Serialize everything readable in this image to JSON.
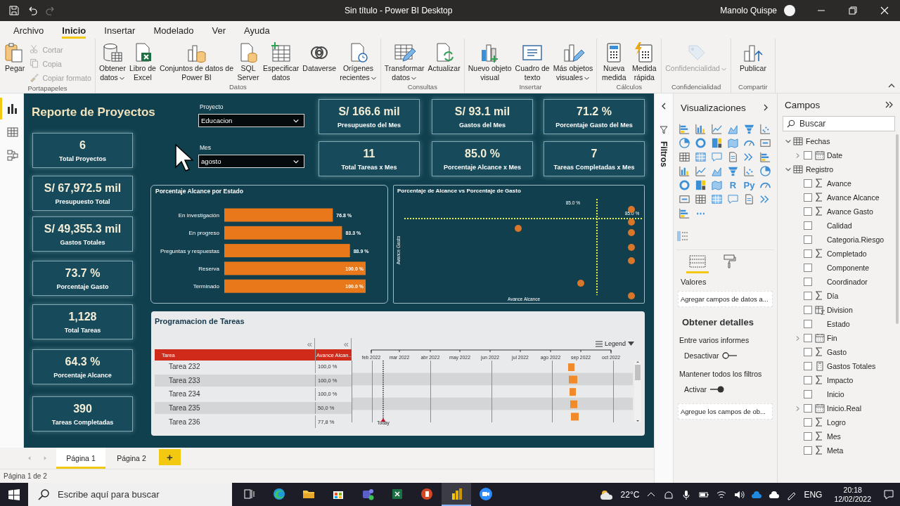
{
  "window": {
    "title": "Sin título - Power BI Desktop",
    "user": "Manolo Quispe"
  },
  "ribbon_tabs": [
    {
      "label": "Archivo",
      "selected": false
    },
    {
      "label": "Inicio",
      "selected": true
    },
    {
      "label": "Insertar",
      "selected": false
    },
    {
      "label": "Modelado",
      "selected": false
    },
    {
      "label": "Ver",
      "selected": false
    },
    {
      "label": "Ayuda",
      "selected": false
    }
  ],
  "ribbon_groups": [
    {
      "name": "Portapapeles",
      "buttons": [
        {
          "label": "Pegar",
          "kind": "large",
          "disabled": false,
          "menu": false
        },
        {
          "label": "Cortar",
          "kind": "small",
          "disabled": true,
          "menu": false
        },
        {
          "label": "Copia",
          "kind": "small",
          "disabled": true,
          "menu": false
        },
        {
          "label": "Copiar formato",
          "kind": "small",
          "disabled": true,
          "menu": false
        }
      ]
    },
    {
      "name": "Datos",
      "buttons": [
        {
          "label": "Obtener\ndatos",
          "kind": "large",
          "disabled": false,
          "menu": true
        },
        {
          "label": "Libro de\nExcel",
          "kind": "large",
          "disabled": false,
          "menu": false
        },
        {
          "label": "Conjuntos de datos de\nPower BI",
          "kind": "large",
          "disabled": false,
          "menu": false
        },
        {
          "label": "SQL\nServer",
          "kind": "large",
          "disabled": false,
          "menu": false
        },
        {
          "label": "Especificar\ndatos",
          "kind": "large",
          "disabled": false,
          "menu": false
        },
        {
          "label": "Dataverse",
          "kind": "large",
          "disabled": false,
          "menu": false
        },
        {
          "label": "Orígenes\nrecientes",
          "kind": "large",
          "disabled": false,
          "menu": true
        }
      ]
    },
    {
      "name": "Consultas",
      "buttons": [
        {
          "label": "Transformar\ndatos",
          "kind": "large",
          "disabled": false,
          "menu": true
        },
        {
          "label": "Actualizar",
          "kind": "large",
          "disabled": false,
          "menu": false
        }
      ]
    },
    {
      "name": "Insertar",
      "buttons": [
        {
          "label": "Nuevo objeto\nvisual",
          "kind": "large",
          "disabled": false,
          "menu": false
        },
        {
          "label": "Cuadro de\ntexto",
          "kind": "large",
          "disabled": false,
          "menu": false
        },
        {
          "label": "Más objetos\nvisuales",
          "kind": "large",
          "disabled": false,
          "menu": true
        }
      ]
    },
    {
      "name": "Cálculos",
      "buttons": [
        {
          "label": "Nueva\nmedida",
          "kind": "large",
          "disabled": false,
          "menu": false
        },
        {
          "label": "Medida\nrápida",
          "kind": "large",
          "disabled": false,
          "menu": false
        }
      ]
    },
    {
      "name": "Confidencialidad",
      "buttons": [
        {
          "label": "Confidencialidad",
          "kind": "large",
          "disabled": true,
          "menu": true
        }
      ]
    },
    {
      "name": "Compartir",
      "buttons": [
        {
          "label": "Publicar",
          "kind": "large",
          "disabled": false,
          "menu": false
        }
      ]
    }
  ],
  "view_rail": [
    {
      "selected": true
    },
    {
      "selected": false
    },
    {
      "selected": false
    }
  ],
  "report": {
    "title": "Reporte de Proyectos",
    "slicers": [
      {
        "label": "Proyecto",
        "value": "Educacion"
      },
      {
        "label": "Mes",
        "value": "agosto"
      }
    ],
    "side_cards": [
      {
        "value": "6",
        "label": "Total Proyectos"
      },
      {
        "value": "S/ 67,972.5 mil",
        "label": "Presupuesto Total"
      },
      {
        "value": "S/ 49,355.3 mil",
        "label": "Gastos Totales"
      },
      {
        "value": "73.7 %",
        "label": "Porcentaje Gasto"
      },
      {
        "value": "1,128",
        "label": "Total Tareas"
      },
      {
        "value": "64.3 %",
        "label": "Porcentaje Alcance"
      },
      {
        "value": "390",
        "label": "Tareas Completadas"
      }
    ],
    "top_cards": [
      {
        "value": "S/ 166.6 mil",
        "label": "Presupuesto del Mes"
      },
      {
        "value": "S/ 93.1 mil",
        "label": "Gastos del Mes"
      },
      {
        "value": "71.2 %",
        "label": "Porcentaje Gasto del Mes"
      },
      {
        "value": "11",
        "label": "Total Tareas x Mes"
      },
      {
        "value": "85.0 %",
        "label": "Porcentaje Alcance x Mes"
      },
      {
        "value": "7",
        "label": "Tareas Completadas x Mes"
      }
    ],
    "bar_chart": {
      "chart_data": {
        "type": "bar",
        "orientation": "horizontal",
        "title": "Porcentaje Alcance por Estado",
        "categories": [
          "En investigación",
          "En progreso",
          "Preguntas y respuestas",
          "Reserva",
          "Terminado"
        ],
        "values": [
          76.8,
          83.3,
          88.9,
          100.0,
          100.0
        ],
        "value_labels": [
          "76.8 %",
          "83.3 %",
          "88.9 %",
          "100.0 %",
          "100.0 %"
        ]
      }
    },
    "scatter": {
      "title": "Porcentaje de Alcance vs Porcentaje de Gasto",
      "xlabel": "Avance Alcance",
      "ylabel": "Avance Gasto",
      "reference_labels": [
        "85.0 %",
        "85.0 %"
      ]
    },
    "gantt": {
      "title": "Programacion de Tareas",
      "collapse_buttons": [
        "«",
        "«"
      ],
      "legend": "Legend",
      "columns": [
        "Tarea",
        "Avance Alcan..."
      ],
      "months": [
        "feb 2022",
        "mar 2022",
        "abr 2022",
        "may 2022",
        "jun 2022",
        "jul 2022",
        "ago 2022",
        "sep 2022",
        "oct 2022"
      ],
      "rows": [
        {
          "task": "Tarea 232",
          "progress": "100,0 %"
        },
        {
          "task": "Tarea 233",
          "progress": "100,0 %"
        },
        {
          "task": "Tarea 234",
          "progress": "100,0 %"
        },
        {
          "task": "Tarea 235",
          "progress": "50,0 %"
        },
        {
          "task": "Tarea 236",
          "progress": "77,8 %"
        }
      ],
      "today": "Today"
    }
  },
  "filters_pane": {
    "label": "Filtros"
  },
  "visualizations": {
    "title": "Visualizaciones",
    "gallery": [
      {
        "kind": "icon"
      },
      {
        "kind": "icon"
      },
      {
        "kind": "icon"
      },
      {
        "kind": "icon"
      },
      {
        "kind": "icon"
      },
      {
        "kind": "icon"
      },
      {
        "kind": "icon"
      },
      {
        "kind": "icon"
      },
      {
        "kind": "icon"
      },
      {
        "kind": "icon"
      },
      {
        "kind": "icon"
      },
      {
        "kind": "icon"
      },
      {
        "kind": "icon"
      },
      {
        "kind": "icon"
      },
      {
        "kind": "icon"
      },
      {
        "kind": "icon"
      },
      {
        "kind": "icon"
      },
      {
        "kind": "icon"
      },
      {
        "kind": "icon"
      },
      {
        "kind": "icon"
      },
      {
        "kind": "icon"
      },
      {
        "kind": "icon"
      },
      {
        "kind": "icon"
      },
      {
        "kind": "icon"
      },
      {
        "kind": "icon"
      },
      {
        "kind": "icon"
      },
      {
        "kind": "icon"
      },
      {
        "kind": "text",
        "label": "R"
      },
      {
        "kind": "text",
        "label": "Py"
      },
      {
        "kind": "icon"
      },
      {
        "kind": "icon"
      },
      {
        "kind": "icon"
      },
      {
        "kind": "icon"
      },
      {
        "kind": "icon"
      },
      {
        "kind": "icon"
      },
      {
        "kind": "icon"
      },
      {
        "kind": "icon"
      },
      {
        "kind": "text",
        "label": "⋯"
      }
    ],
    "well_tabs": [
      {
        "selected": true
      },
      {
        "selected": false
      }
    ],
    "well_label": "Valores",
    "well_hint": "Agregar campos de datos a...",
    "drill_title": "Obtener detalles",
    "settings": [
      {
        "label": "Entre varios informes",
        "toggle_label": "Desactivar",
        "on": false
      },
      {
        "label": "Mantener todos los filtros",
        "toggle_label": "Activar",
        "on": true
      }
    ],
    "drill_hint": "Agregue los campos de ob..."
  },
  "fields": {
    "title": "Campos",
    "search_placeholder": "Buscar",
    "tables": [
      {
        "name": "Fechas",
        "expanded": true,
        "children": [
          {
            "name": "Date",
            "kind": "date",
            "expanded": false,
            "checked": false
          }
        ]
      },
      {
        "name": "Registro",
        "expanded": true,
        "children": [
          {
            "name": "Avance",
            "kind": "sum",
            "checked": false
          },
          {
            "name": "Avance Alcance",
            "kind": "sum",
            "checked": false
          },
          {
            "name": "Avance Gasto",
            "kind": "sum",
            "checked": false
          },
          {
            "name": "Calidad",
            "kind": "text",
            "checked": false
          },
          {
            "name": "Categoria.Riesgo",
            "kind": "text",
            "checked": false
          },
          {
            "name": "Completado",
            "kind": "sum",
            "checked": false
          },
          {
            "name": "Componente",
            "kind": "text",
            "checked": false
          },
          {
            "name": "Coordinador",
            "kind": "text",
            "checked": false
          },
          {
            "name": "Día",
            "kind": "sum",
            "checked": false
          },
          {
            "name": "Division",
            "kind": "group",
            "checked": false
          },
          {
            "name": "Estado",
            "kind": "text",
            "checked": false
          },
          {
            "name": "Fin",
            "kind": "date",
            "expanded": false,
            "checked": false
          },
          {
            "name": "Gasto",
            "kind": "sum",
            "checked": false
          },
          {
            "name": "Gastos Totales",
            "kind": "measure",
            "checked": false
          },
          {
            "name": "Impacto",
            "kind": "sum",
            "checked": false
          },
          {
            "name": "Inicio",
            "kind": "text",
            "checked": false
          },
          {
            "name": "Inicio.Real",
            "kind": "date",
            "expanded": false,
            "checked": false
          },
          {
            "name": "Logro",
            "kind": "sum",
            "checked": false
          },
          {
            "name": "Mes",
            "kind": "sum",
            "checked": false
          },
          {
            "name": "Meta",
            "kind": "sum",
            "checked": false
          }
        ]
      }
    ]
  },
  "pages": [
    {
      "label": "Página 1",
      "selected": true
    },
    {
      "label": "Página 2",
      "selected": false
    }
  ],
  "add_page": "+",
  "status_bar": "Página 1 de 2",
  "taskbar": {
    "search_placeholder": "Escribe aquí para buscar",
    "apps": [
      {
        "active": false
      },
      {
        "active": false
      },
      {
        "active": false
      },
      {
        "active": false
      },
      {
        "active": false
      },
      {
        "active": false
      },
      {
        "active": false
      },
      {
        "active": true
      },
      {
        "active": false
      }
    ],
    "temperature": "22°C",
    "language": "ENG",
    "time": "20:18",
    "date": "12/02/2022"
  }
}
